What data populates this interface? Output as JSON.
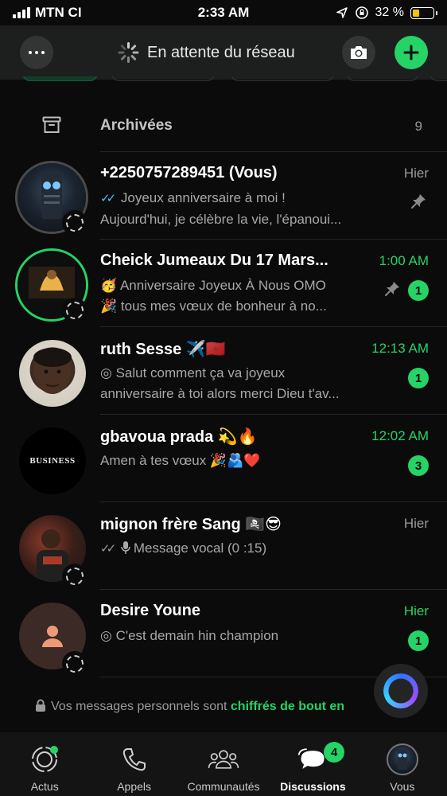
{
  "status_bar": {
    "carrier": "MTN CI",
    "time": "2:33 AM",
    "battery_percent": "32 %",
    "battery_level": 0.32
  },
  "header": {
    "title": "En attente du réseau",
    "menu_icon": "more-horizontal-icon",
    "camera_icon": "camera-icon",
    "add_icon": "plus-icon",
    "accent": "#25d366"
  },
  "archived": {
    "label": "Archivées",
    "count": "9"
  },
  "chats": [
    {
      "name": "+2250757289451 (Vous)",
      "time": "Hier",
      "time_highlight": false,
      "ticks": "✓✓",
      "line1": "Joyeux anniversaire à moi !",
      "line2": "Aujourd'hui, je célèbre la vie, l'épanoui...",
      "pinned": true,
      "unread": ""
    },
    {
      "name": "Cheick Jumeaux Du 17 Mars...",
      "time": "1:00 AM",
      "time_highlight": true,
      "line1_emoji": "🥳",
      "line1": "Anniversaire Joyeux À Nous OMO",
      "line2_emoji": "🎉",
      "line2": "tous mes vœux de bonheur à no...",
      "pinned": true,
      "unread": "1"
    },
    {
      "name": "ruth Sesse ✈️🇲🇦",
      "time": "12:13 AM",
      "time_highlight": true,
      "line1": "Salut comment ça va joyeux",
      "line2": "anniversaire à toi alors merci Dieu t'av...",
      "unread": "1"
    },
    {
      "name": "gbavoua prada 💫🔥",
      "avatar_text": "BUSINESS",
      "time": "12:02 AM",
      "time_highlight": true,
      "line1": "Amen à tes vœux 🎉🫂❤️",
      "unread": "3"
    },
    {
      "name": "mignon frère Sang 🏴‍☠️😎",
      "time": "Hier",
      "time_highlight": false,
      "ticks": "✓✓",
      "line1": "Message vocal (0 :15)"
    },
    {
      "name": "Desire Youne",
      "time": "Hier",
      "time_highlight": true,
      "line1": "C'est demain hin champion",
      "unread": "1"
    }
  ],
  "encryption": {
    "text": "Vos messages personnels sont ",
    "link": "chiffrés de bout en"
  },
  "tabs": [
    {
      "label": "Actus",
      "icon": "updates-icon"
    },
    {
      "label": "Appels",
      "icon": "phone-icon"
    },
    {
      "label": "Communautés",
      "icon": "communities-icon"
    },
    {
      "label": "Discussions",
      "icon": "chats-icon",
      "badge": "4"
    },
    {
      "label": "Vous",
      "icon": "profile-avatar"
    }
  ]
}
